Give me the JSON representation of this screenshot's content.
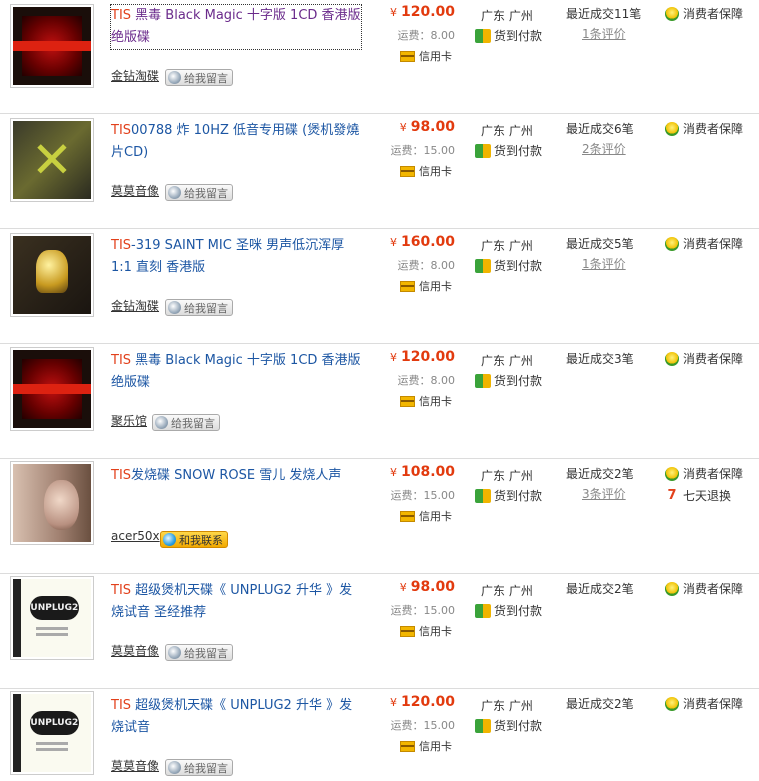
{
  "items": [
    {
      "title_kw": "TIS",
      "title_rest": " 黑毒 Black Magic 十字版 1CD 香港版 绝版碟",
      "price": "120.00",
      "shipping": "运费：8.00",
      "card": "信用卡",
      "location": "广东 广州",
      "cod": "货到付款",
      "sales": "最近成交11笔",
      "reviews": "1条评价",
      "guarantee": "消费者保障",
      "seller": "金钻淘碟",
      "msg": "给我留言",
      "art": "black"
    },
    {
      "title_kw": "TIS",
      "title_rest": "00788 炸 10HZ 低音专用碟 (煲机發燒片CD)",
      "price": "98.00",
      "shipping": "运费：15.00",
      "card": "信用卡",
      "location": "广东 广州",
      "cod": "货到付款",
      "sales": "最近成交6笔",
      "reviews": "2条评价",
      "guarantee": "消费者保障",
      "seller": "莫莫音像",
      "msg": "给我留言",
      "art": "x"
    },
    {
      "title_kw": "TIS",
      "title_rest": "-319 SAINT MIC 圣咪 男声低沉浑厚 1:1 直刻 香港版",
      "price": "160.00",
      "shipping": "运费：8.00",
      "card": "信用卡",
      "location": "广东 广州",
      "cod": "货到付款",
      "sales": "最近成交5笔",
      "reviews": "1条评价",
      "guarantee": "消费者保障",
      "seller": "金钻淘碟",
      "msg": "给我留言",
      "art": "mic"
    },
    {
      "title_kw": "TIS",
      "title_rest": " 黑毒 Black Magic 十字版 1CD 香港版 绝版碟",
      "price": "120.00",
      "shipping": "运费：8.00",
      "card": "信用卡",
      "location": "广东 广州",
      "cod": "货到付款",
      "sales": "最近成交3笔",
      "reviews": "",
      "guarantee": "消费者保障",
      "seller": "聚乐馆",
      "msg": "给我留言",
      "art": "black"
    },
    {
      "title_kw": "TIS",
      "title_rest": "发烧碟 SNOW ROSE 雪儿 发烧人声",
      "price": "108.00",
      "shipping": "运费：15.00",
      "card": "信用卡",
      "location": "广东 广州",
      "cod": "货到付款",
      "sales": "最近成交2笔",
      "reviews": "3条评价",
      "guarantee": "消费者保障",
      "return": "七天退换",
      "seller": "acer50x",
      "msg": "和我联系",
      "art": "rose"
    },
    {
      "title_kw": "TIS",
      "title_rest": " 超级煲机天碟《 UNPLUG2 升华 》发烧试音 圣经推荐",
      "price": "98.00",
      "shipping": "运费：15.00",
      "card": "信用卡",
      "location": "广东 广州",
      "cod": "货到付款",
      "sales": "最近成交2笔",
      "reviews": "",
      "guarantee": "消费者保障",
      "seller": "莫莫音像",
      "msg": "给我留言",
      "art": "plug"
    },
    {
      "title_kw": "TIS",
      "title_rest": " 超级煲机天碟《 UNPLUG2 升华 》发烧试音",
      "price": "120.00",
      "shipping": "运费：15.00",
      "card": "信用卡",
      "location": "广东 广州",
      "cod": "货到付款",
      "sales": "最近成交2笔",
      "reviews": "",
      "guarantee": "消费者保障",
      "seller": "莫莫音像",
      "msg": "给我留言",
      "art": "plug"
    }
  ],
  "currency": "¥",
  "plug_logo": "UNPLUG2",
  "colors": {
    "link": "#1c56a3",
    "keyword": "#e2411c",
    "price": "#e23a0e"
  }
}
